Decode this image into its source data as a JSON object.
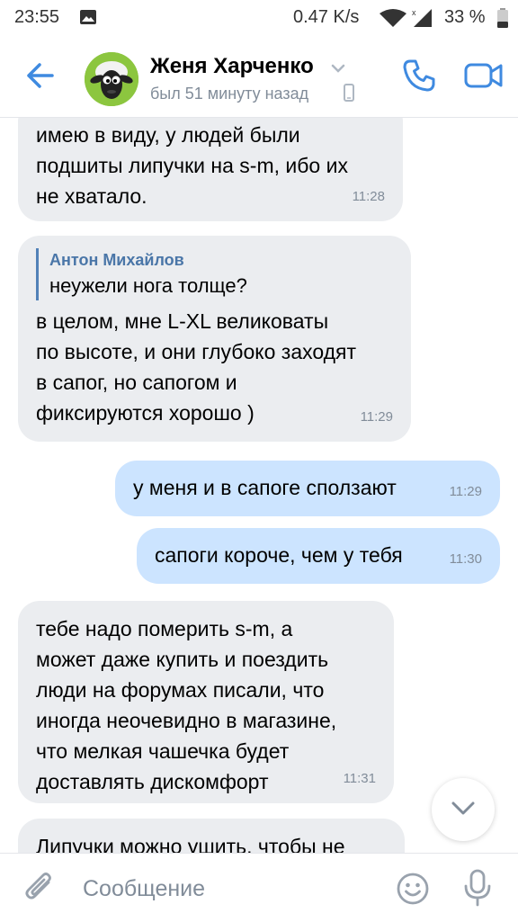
{
  "status_bar": {
    "time": "23:55",
    "network_speed": "0.47 K/s",
    "battery": "33 %"
  },
  "header": {
    "contact_name": "Женя Харченко",
    "last_seen": "был 51 минуту назад"
  },
  "messages": [
    {
      "direction": "in",
      "text": "имею в виду, у людей были\nподшиты липучки на s-m, ибо их\nне хватало.",
      "time": "11:28"
    },
    {
      "direction": "in",
      "reply_author": "Антон Михайлов",
      "reply_text": "неужели нога толще?",
      "text": "в целом, мне L-XL великоваты\nпо высоте, и они глубоко заходят\nв сапог, но сапогом и\nфиксируются хорошо )",
      "time": "11:29"
    },
    {
      "direction": "out",
      "text": "у меня и в сапоге сползают",
      "time": "11:29"
    },
    {
      "direction": "out",
      "text": "сапоги короче, чем у тебя",
      "time": "11:30"
    },
    {
      "direction": "in",
      "text": "тебе надо померить s-m, а\nможет даже купить и поездить\nлюди на форумах писали, что\nиногда неочевидно в магазине,\nчто мелкая чашечка будет\nдоставлять дискомфорт",
      "time": "11:31"
    },
    {
      "direction": "in",
      "text": "Липучки можно ушить, чтобы не",
      "time": ""
    }
  ],
  "composer": {
    "placeholder": "Сообщение"
  },
  "icons": {
    "back": "arrow-left-icon",
    "call": "phone-icon",
    "video": "video-camera-icon",
    "attach": "paperclip-icon",
    "emoji": "smile-icon",
    "mic": "microphone-icon",
    "scroll_down": "chevron-down-icon"
  },
  "colors": {
    "accent": "#3f8ae0",
    "incoming_bubble": "#ebedf0",
    "outgoing_bubble": "#cce4ff",
    "secondary_text": "#818c99",
    "reply_author": "#4a76a8"
  }
}
